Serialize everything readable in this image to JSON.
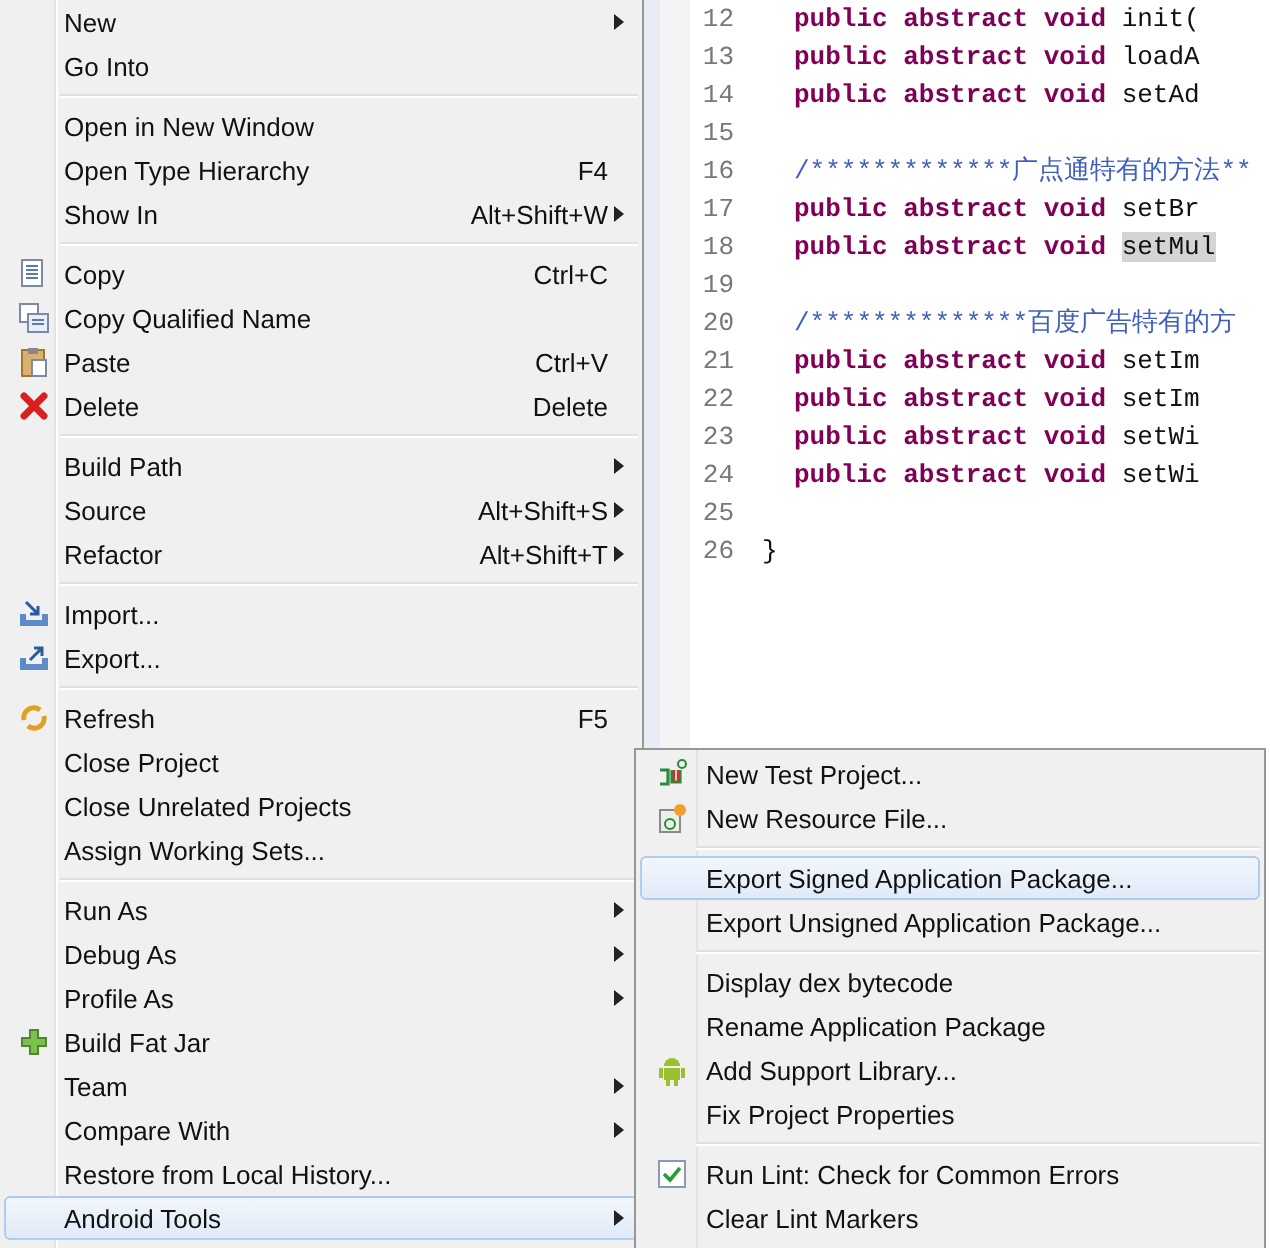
{
  "editor": {
    "lines": [
      {
        "number": "12",
        "indented": true,
        "parts": [
          {
            "kind": "keyword",
            "text": "public abstract void"
          },
          {
            "kind": "plain",
            "text": "init("
          }
        ]
      },
      {
        "number": "13",
        "indented": true,
        "parts": [
          {
            "kind": "keyword",
            "text": "public abstract void"
          },
          {
            "kind": "plain",
            "text": "loadA"
          }
        ]
      },
      {
        "number": "14",
        "indented": true,
        "parts": [
          {
            "kind": "keyword",
            "text": "public abstract void"
          },
          {
            "kind": "plain",
            "text": "setAd"
          }
        ]
      },
      {
        "number": "15",
        "indented": true
      },
      {
        "number": "16",
        "indented": true,
        "parts": [
          {
            "kind": "comment",
            "text": "/*************广点通特有的方法**"
          }
        ]
      },
      {
        "number": "17",
        "indented": true,
        "parts": [
          {
            "kind": "keyword",
            "text": "public abstract void"
          },
          {
            "kind": "plain",
            "text": "setBr"
          }
        ]
      },
      {
        "number": "18",
        "indented": true,
        "parts": [
          {
            "kind": "keyword",
            "text": "public abstract void"
          },
          {
            "kind": "occurrence",
            "text": "setMul"
          }
        ]
      },
      {
        "number": "19",
        "indented": true
      },
      {
        "number": "20",
        "indented": true,
        "parts": [
          {
            "kind": "comment",
            "text": "/**************百度广告特有的方"
          }
        ]
      },
      {
        "number": "21",
        "indented": true,
        "parts": [
          {
            "kind": "keyword",
            "text": "public abstract void"
          },
          {
            "kind": "plain",
            "text": "setIm"
          }
        ]
      },
      {
        "number": "22",
        "indented": true,
        "parts": [
          {
            "kind": "keyword",
            "text": "public abstract void"
          },
          {
            "kind": "plain",
            "text": "setIm"
          }
        ]
      },
      {
        "number": "23",
        "indented": true,
        "parts": [
          {
            "kind": "keyword",
            "text": "public abstract void"
          },
          {
            "kind": "plain",
            "text": "setWi"
          }
        ]
      },
      {
        "number": "24",
        "indented": true,
        "parts": [
          {
            "kind": "keyword",
            "text": "public abstract void"
          },
          {
            "kind": "plain",
            "text": "setWi"
          }
        ]
      },
      {
        "number": "25",
        "indented": true
      },
      {
        "number": "26",
        "indented": false,
        "parts": [
          {
            "kind": "plain",
            "text": "}"
          }
        ]
      }
    ]
  },
  "context_menu": {
    "items": [
      {
        "kind": "item",
        "label": "New",
        "submenu": true,
        "selected": false
      },
      {
        "kind": "item",
        "label": "Go Into",
        "submenu": false,
        "selected": false
      },
      {
        "kind": "separator"
      },
      {
        "kind": "item",
        "label": "Open in New Window",
        "submenu": false,
        "selected": false
      },
      {
        "kind": "item",
        "label": "Open Type Hierarchy",
        "shortcut": "F4",
        "submenu": false,
        "selected": false
      },
      {
        "kind": "item",
        "label": "Show In",
        "shortcut": "Alt+Shift+W",
        "submenu": true,
        "selected": false
      },
      {
        "kind": "separator"
      },
      {
        "kind": "item",
        "label": "Copy",
        "shortcut": "Ctrl+C",
        "submenu": false,
        "selected": false
      },
      {
        "kind": "item",
        "label": "Copy Qualified Name",
        "submenu": false,
        "selected": false
      },
      {
        "kind": "item",
        "label": "Paste",
        "shortcut": "Ctrl+V",
        "submenu": false,
        "selected": false
      },
      {
        "kind": "item",
        "label": "Delete",
        "shortcut": "Delete",
        "submenu": false,
        "selected": false
      },
      {
        "kind": "separator"
      },
      {
        "kind": "item",
        "label": "Build Path",
        "submenu": true,
        "selected": false
      },
      {
        "kind": "item",
        "label": "Source",
        "shortcut": "Alt+Shift+S",
        "submenu": true,
        "selected": false
      },
      {
        "kind": "item",
        "label": "Refactor",
        "shortcut": "Alt+Shift+T",
        "submenu": true,
        "selected": false
      },
      {
        "kind": "separator"
      },
      {
        "kind": "item",
        "label": "Import...",
        "submenu": false,
        "selected": false
      },
      {
        "kind": "item",
        "label": "Export...",
        "submenu": false,
        "selected": false
      },
      {
        "kind": "separator"
      },
      {
        "kind": "item",
        "label": "Refresh",
        "shortcut": "F5",
        "submenu": false,
        "selected": false
      },
      {
        "kind": "item",
        "label": "Close Project",
        "submenu": false,
        "selected": false
      },
      {
        "kind": "item",
        "label": "Close Unrelated Projects",
        "submenu": false,
        "selected": false
      },
      {
        "kind": "item",
        "label": "Assign Working Sets...",
        "submenu": false,
        "selected": false
      },
      {
        "kind": "separator"
      },
      {
        "kind": "item",
        "label": "Run As",
        "submenu": true,
        "selected": false
      },
      {
        "kind": "item",
        "label": "Debug As",
        "submenu": true,
        "selected": false
      },
      {
        "kind": "item",
        "label": "Profile As",
        "submenu": true,
        "selected": false
      },
      {
        "kind": "item",
        "label": "Build Fat Jar",
        "submenu": false,
        "selected": false
      },
      {
        "kind": "item",
        "label": "Team",
        "submenu": true,
        "selected": false
      },
      {
        "kind": "item",
        "label": "Compare With",
        "submenu": true,
        "selected": false
      },
      {
        "kind": "item",
        "label": "Restore from Local History...",
        "submenu": false,
        "selected": false
      },
      {
        "kind": "item",
        "label": "Android Tools",
        "submenu": true,
        "selected": true
      }
    ]
  },
  "submenu": {
    "items": [
      {
        "kind": "item",
        "label": "New Test Project...",
        "selected": false
      },
      {
        "kind": "item",
        "label": "New Resource File...",
        "selected": false
      },
      {
        "kind": "separator"
      },
      {
        "kind": "item",
        "label": "Export Signed Application Package...",
        "selected": true
      },
      {
        "kind": "item",
        "label": "Export Unsigned Application Package...",
        "selected": false
      },
      {
        "kind": "separator"
      },
      {
        "kind": "item",
        "label": "Display dex bytecode",
        "selected": false
      },
      {
        "kind": "item",
        "label": "Rename Application Package",
        "selected": false
      },
      {
        "kind": "item",
        "label": "Add Support Library...",
        "selected": false
      },
      {
        "kind": "item",
        "label": "Fix Project Properties",
        "selected": false
      },
      {
        "kind": "separator"
      },
      {
        "kind": "item",
        "label": "Run Lint: Check for Common Errors",
        "selected": false
      },
      {
        "kind": "item",
        "label": "Clear Lint Markers",
        "selected": false
      }
    ]
  }
}
